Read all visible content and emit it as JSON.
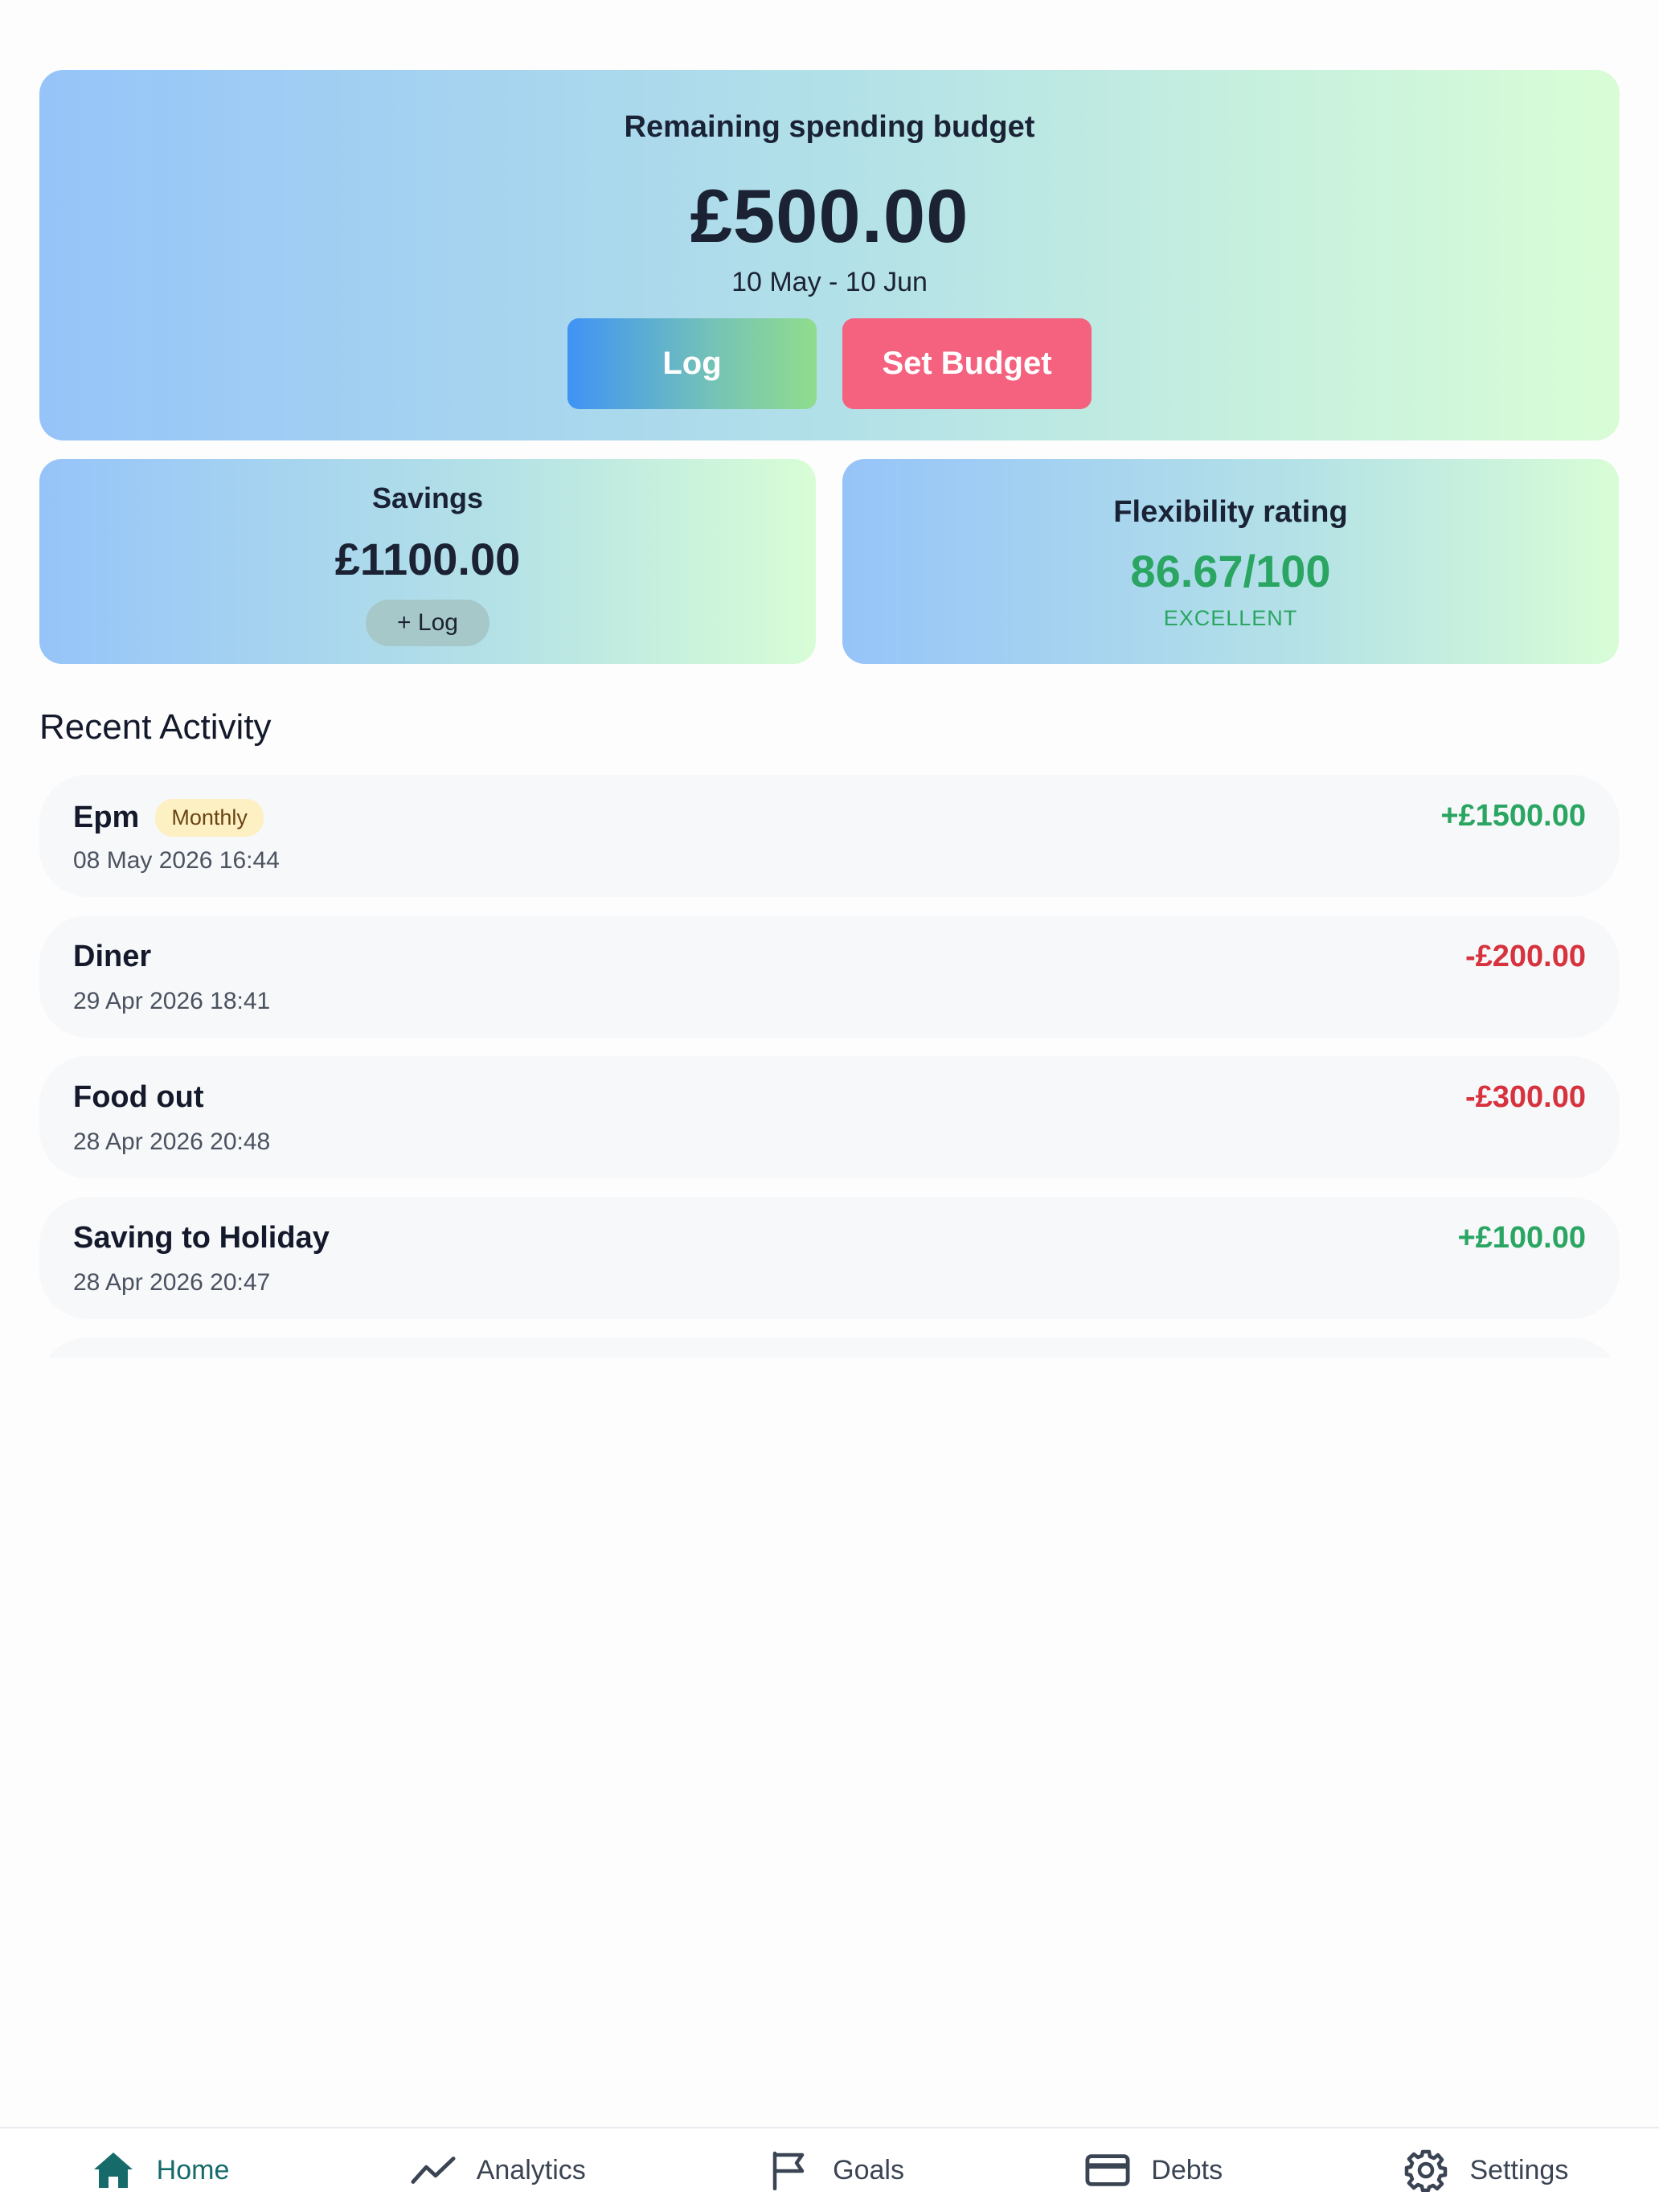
{
  "budget": {
    "title": "Remaining spending budget",
    "amount": "£500.00",
    "range": "10 May - 10 Jun",
    "log_label": "Log",
    "set_budget_label": "Set Budget"
  },
  "savings": {
    "title": "Savings",
    "amount": "£1100.00",
    "log_label": "+ Log"
  },
  "flexibility": {
    "title": "Flexibility rating",
    "value": "86.67/100",
    "label": "EXCELLENT"
  },
  "recent_activity": {
    "title": "Recent Activity",
    "items": [
      {
        "name": "Epm",
        "badge": "Monthly",
        "date": "08 May 2026 16:44",
        "amount": "+£1500.00",
        "sign": "pos"
      },
      {
        "name": "Diner",
        "date": "29 Apr 2026 18:41",
        "amount": "-£200.00",
        "sign": "neg"
      },
      {
        "name": "Food out",
        "date": "28 Apr 2026 20:48",
        "amount": "-£300.00",
        "sign": "neg"
      },
      {
        "name": "Saving to Holiday",
        "date": "28 Apr 2026 20:47",
        "amount": "+£100.00",
        "sign": "pos"
      }
    ]
  },
  "nav": {
    "items": [
      {
        "label": "Home",
        "icon": "home-icon",
        "active": true
      },
      {
        "label": "Analytics",
        "icon": "trend-icon"
      },
      {
        "label": "Goals",
        "icon": "flag-icon"
      },
      {
        "label": "Debts",
        "icon": "card-icon"
      },
      {
        "label": "Settings",
        "icon": "gear-icon"
      }
    ]
  },
  "colors": {
    "positive": "#2aa562",
    "negative": "#d7333e",
    "set_budget": "#f4627f",
    "nav_active": "#166b6a"
  }
}
